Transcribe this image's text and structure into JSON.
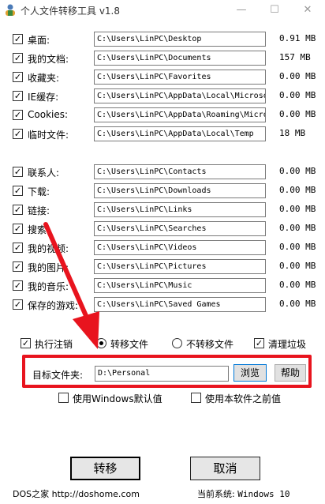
{
  "window": {
    "title": "个人文件转移工具 v1.8",
    "min_icon": "minimize-icon",
    "max_icon": "maximize-icon",
    "close_icon": "close-icon"
  },
  "rows": [
    {
      "label": "桌面:",
      "path": "C:\\Users\\LinPC\\Desktop",
      "size": "0.91 MB",
      "checked": true
    },
    {
      "label": "我的文档:",
      "path": "C:\\Users\\LinPC\\Documents",
      "size": "157 MB",
      "checked": true
    },
    {
      "label": "收藏夹:",
      "path": "C:\\Users\\LinPC\\Favorites",
      "size": "0.00 MB",
      "checked": true
    },
    {
      "label": "IE缓存:",
      "path": "C:\\Users\\LinPC\\AppData\\Local\\Microso",
      "size": "0.00 MB",
      "checked": true
    },
    {
      "label": "Cookies:",
      "path": "C:\\Users\\LinPC\\AppData\\Roaming\\Micro",
      "size": "0.00 MB",
      "checked": true
    },
    {
      "label": "临时文件:",
      "path": "C:\\Users\\LinPC\\AppData\\Local\\Temp",
      "size": "18 MB",
      "checked": true
    },
    {
      "label": "联系人:",
      "path": "C:\\Users\\LinPC\\Contacts",
      "size": "0.00 MB",
      "checked": true
    },
    {
      "label": "下载:",
      "path": "C:\\Users\\LinPC\\Downloads",
      "size": "0.00 MB",
      "checked": true
    },
    {
      "label": "链接:",
      "path": "C:\\Users\\LinPC\\Links",
      "size": "0.00 MB",
      "checked": true
    },
    {
      "label": "搜索:",
      "path": "C:\\Users\\LinPC\\Searches",
      "size": "0.00 MB",
      "checked": true
    },
    {
      "label": "我的视频:",
      "path": "C:\\Users\\LinPC\\Videos",
      "size": "0.00 MB",
      "checked": true
    },
    {
      "label": "我的图片:",
      "path": "C:\\Users\\LinPC\\Pictures",
      "size": "0.00 MB",
      "checked": true
    },
    {
      "label": "我的音乐:",
      "path": "C:\\Users\\LinPC\\Music",
      "size": "0.00 MB",
      "checked": true
    },
    {
      "label": "保存的游戏:",
      "path": "C:\\Users\\LinPC\\Saved Games",
      "size": "0.00 MB",
      "checked": true
    }
  ],
  "options": {
    "run_logoff": "执行注销",
    "move_files": "转移文件",
    "no_move_files": "不转移文件",
    "clean_junk": "清理垃圾",
    "mode": "move"
  },
  "target": {
    "label": "目标文件夹:",
    "value": "D:\\Personal",
    "browse": "浏览",
    "help": "帮助",
    "use_windows_default": "使用Windows默认值",
    "use_previous": "使用本软件之前值"
  },
  "actions": {
    "move": "转移",
    "cancel": "取消"
  },
  "status": {
    "left": "DOS之家 http://doshome.com",
    "system_label": "当前系统:",
    "system_value": "Windows 10"
  },
  "colors": {
    "highlight": "#e8141e"
  }
}
